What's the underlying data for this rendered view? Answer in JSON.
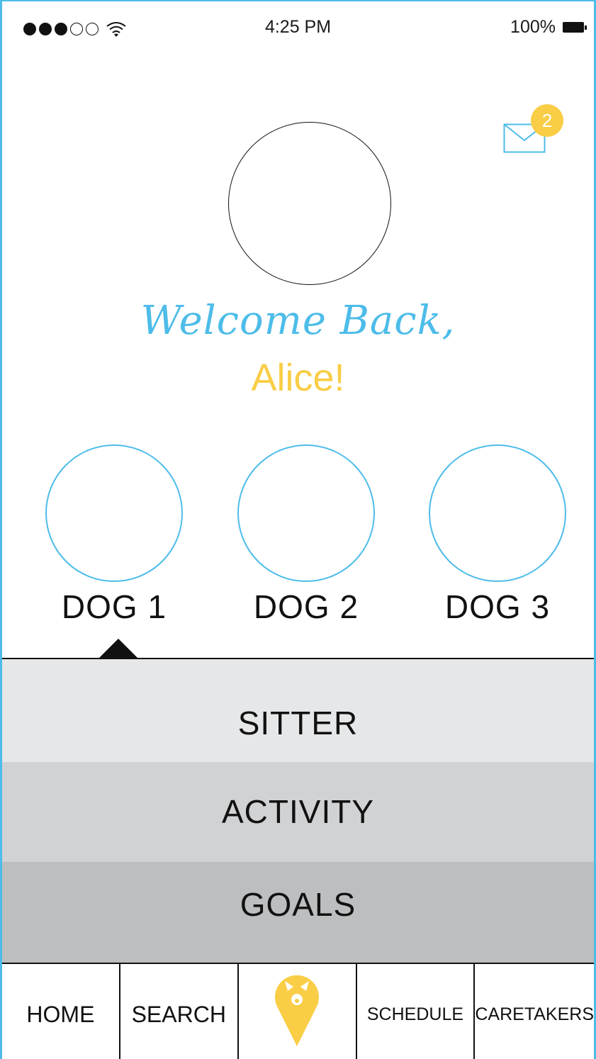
{
  "status_bar": {
    "time": "4:25 PM",
    "battery": "100%",
    "signal_dots_filled": 3,
    "signal_dots_total": 5,
    "icons": [
      "wifi-icon",
      "battery-icon"
    ]
  },
  "messages": {
    "icon": "mail-icon",
    "badge_count": "2"
  },
  "profile": {
    "welcome": "Welcome Back,",
    "name": "Alice!"
  },
  "dogs": [
    {
      "label": "DOG 1"
    },
    {
      "label": "DOG 2"
    },
    {
      "label": "DOG 3"
    }
  ],
  "selected_dog": "DOG 1",
  "menu": {
    "sitter": "SITTER",
    "activity": "ACTIVITY",
    "goals": "GOALS"
  },
  "tabs": {
    "home": "HOME",
    "search": "SEARCH",
    "center_icon": "dog-pin-icon",
    "schedule": "SCHEDULE",
    "caretakers": "CARETAKERS"
  },
  "colors": {
    "accent_blue": "#4dbce9",
    "accent_yellow": "#f9cd46",
    "row_light": "#e6e7e8",
    "row_mid": "#d1d2d4",
    "row_dark": "#bcbec0"
  }
}
